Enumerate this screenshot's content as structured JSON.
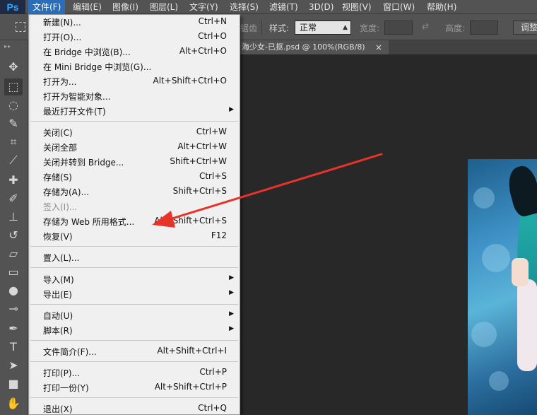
{
  "app": {
    "logo": "Ps"
  },
  "menubar": {
    "items": [
      {
        "label": "文件(F)"
      },
      {
        "label": "编辑(E)"
      },
      {
        "label": "图像(I)"
      },
      {
        "label": "图层(L)"
      },
      {
        "label": "文字(Y)"
      },
      {
        "label": "选择(S)"
      },
      {
        "label": "滤镜(T)"
      },
      {
        "label": "3D(D)"
      },
      {
        "label": "视图(V)"
      },
      {
        "label": "窗口(W)"
      },
      {
        "label": "帮助(H)"
      }
    ]
  },
  "options": {
    "partial_text": "锯齿",
    "style_label": "样式:",
    "style_value": "正常",
    "width_label": "宽度:",
    "height_label": "高度:",
    "adjust_label": "调整"
  },
  "document": {
    "tab_title": "海少女-已抠.psd @ 100%(RGB/8)",
    "tab_close": "×"
  },
  "file_menu": {
    "items": [
      {
        "label": "新建(N)...",
        "shortcut": "Ctrl+N"
      },
      {
        "label": "打开(O)...",
        "shortcut": "Ctrl+O"
      },
      {
        "label": "在 Bridge 中浏览(B)...",
        "shortcut": "Alt+Ctrl+O"
      },
      {
        "label": "在 Mini Bridge 中浏览(G)...",
        "shortcut": ""
      },
      {
        "label": "打开为...",
        "shortcut": "Alt+Shift+Ctrl+O"
      },
      {
        "label": "打开为智能对象...",
        "shortcut": ""
      },
      {
        "label": "最近打开文件(T)",
        "shortcut": "",
        "submenu": true
      },
      {
        "label": "关闭(C)",
        "shortcut": "Ctrl+W"
      },
      {
        "label": "关闭全部",
        "shortcut": "Alt+Ctrl+W"
      },
      {
        "label": "关闭并转到 Bridge...",
        "shortcut": "Shift+Ctrl+W"
      },
      {
        "label": "存储(S)",
        "shortcut": "Ctrl+S"
      },
      {
        "label": "存储为(A)...",
        "shortcut": "Shift+Ctrl+S"
      },
      {
        "label": "签入(I)...",
        "shortcut": "",
        "disabled": true
      },
      {
        "label": "存储为 Web 所用格式...",
        "shortcut": "Alt+Shift+Ctrl+S"
      },
      {
        "label": "恢复(V)",
        "shortcut": "F12"
      },
      {
        "label": "置入(L)...",
        "shortcut": ""
      },
      {
        "label": "导入(M)",
        "shortcut": "",
        "submenu": true
      },
      {
        "label": "导出(E)",
        "shortcut": "",
        "submenu": true
      },
      {
        "label": "自动(U)",
        "shortcut": "",
        "submenu": true
      },
      {
        "label": "脚本(R)",
        "shortcut": "",
        "submenu": true
      },
      {
        "label": "文件简介(F)...",
        "shortcut": "Alt+Shift+Ctrl+I"
      },
      {
        "label": "打印(P)...",
        "shortcut": "Ctrl+P"
      },
      {
        "label": "打印一份(Y)",
        "shortcut": "Alt+Shift+Ctrl+P"
      },
      {
        "label": "退出(X)",
        "shortcut": "Ctrl+Q"
      }
    ],
    "submenu_arrow": "▶"
  },
  "annotation": {
    "color": "#e8332a"
  }
}
